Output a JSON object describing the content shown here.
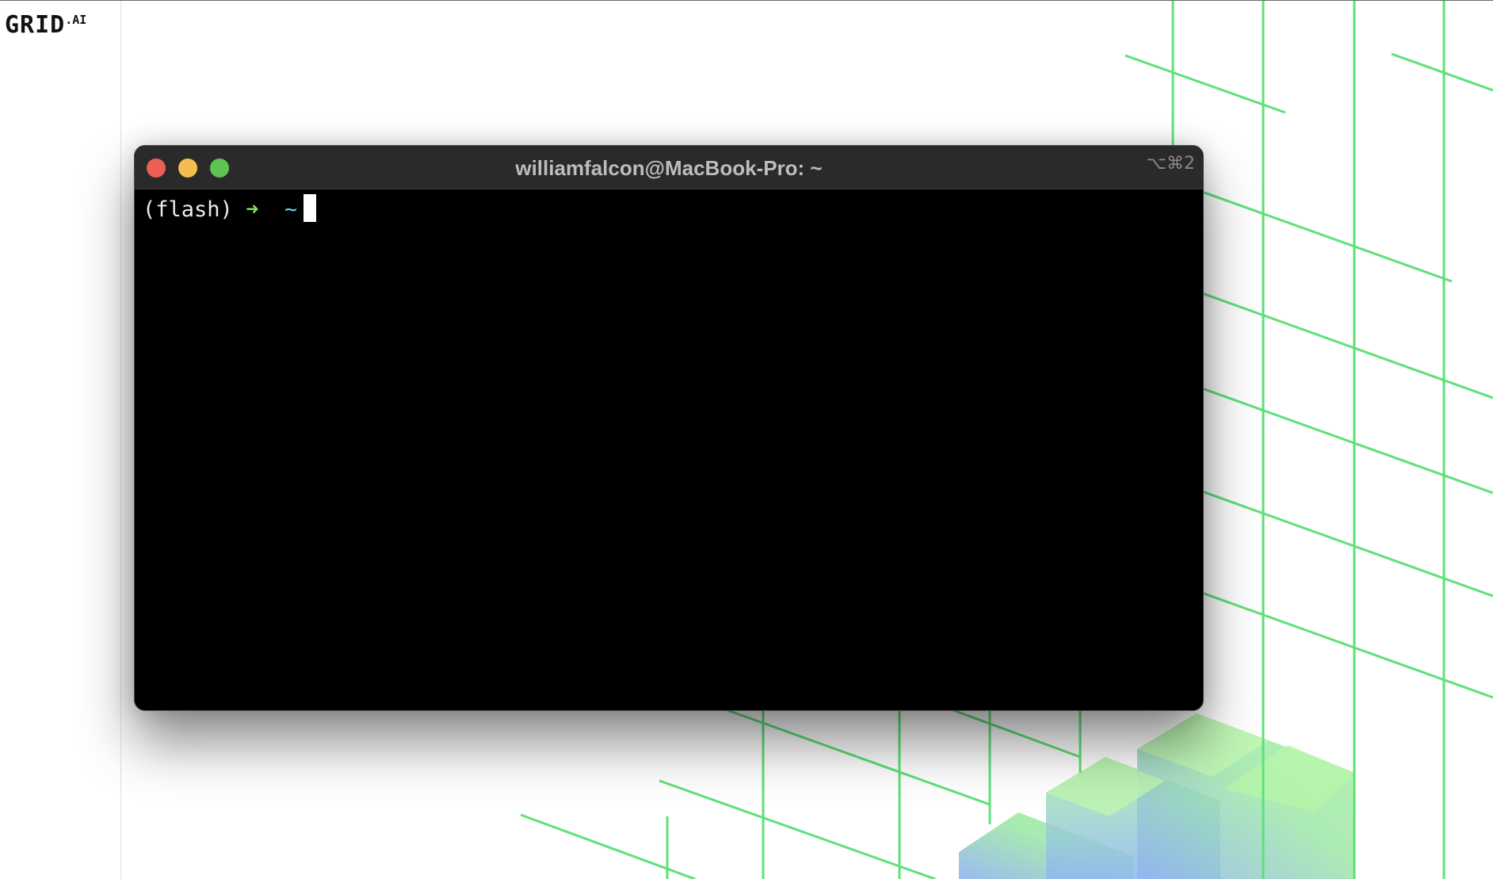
{
  "brand": {
    "logo_text": "GRID",
    "logo_suffix": ".AI"
  },
  "terminal": {
    "title": "williamfalcon@MacBook-Pro: ~",
    "shortcut": "⌥⌘2",
    "prompt": {
      "env": "(flash)",
      "arrow": "➜",
      "cwd": "~"
    }
  },
  "colors": {
    "accent_green": "#5fe07a",
    "traffic_close": "#ed5f56",
    "traffic_minimize": "#f3be4f",
    "traffic_maximize": "#5fc451",
    "terminal_background": "#000000"
  }
}
